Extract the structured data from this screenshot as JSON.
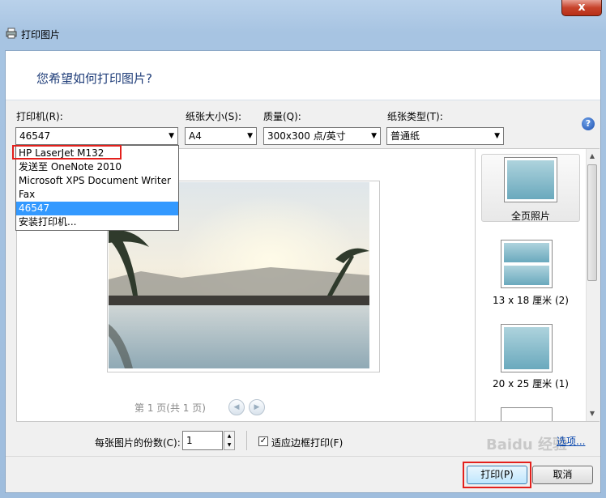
{
  "window": {
    "title": "打印图片",
    "close_label": "x"
  },
  "banner": {
    "question": "您希望如何打印图片?"
  },
  "printer": {
    "label": "打印机(R):",
    "value": "46547",
    "options": [
      "HP LaserJet M132",
      "发送至 OneNote 2010",
      "Microsoft XPS Document Writer",
      "Fax",
      "46547",
      "安装打印机..."
    ],
    "selected_index": 4
  },
  "paper_size": {
    "label": "纸张大小(S):",
    "value": "A4"
  },
  "quality": {
    "label": "质量(Q):",
    "value": "300x300 点/英寸"
  },
  "paper_type": {
    "label": "纸张类型(T):",
    "value": "普通纸"
  },
  "help_icon": "?",
  "preview": {
    "page_status": "第 1 页(共 1 页)"
  },
  "layouts": [
    {
      "label": "全页照片",
      "selected": true
    },
    {
      "label": "13 x 18 厘米 (2)"
    },
    {
      "label": "20 x 25 厘米 (1)"
    }
  ],
  "copies": {
    "label": "每张图片的份数(C):",
    "value": "1"
  },
  "fit_frame": {
    "label": "适应边框打印(F)",
    "checked": true
  },
  "options_link": "选项...",
  "buttons": {
    "print": "打印(P)",
    "cancel": "取消"
  },
  "watermark": "Baidu 经验",
  "colors": {
    "selection": "#3399ff",
    "highlight_box": "#e3201c",
    "link": "#0645ad"
  }
}
